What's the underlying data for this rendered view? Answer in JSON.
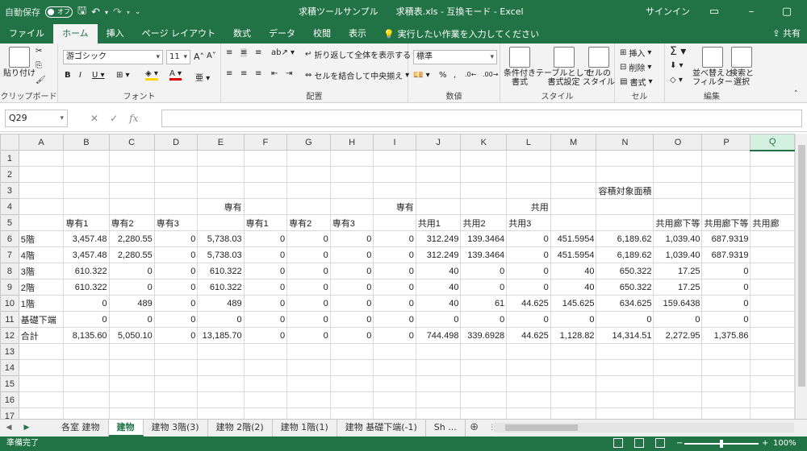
{
  "titlebar": {
    "autosave_label": "自動保存",
    "autosave_state": "オフ",
    "title": "求積ツールサンプル　　求積表.xls - 互換モード - Excel",
    "signin": "サインイン"
  },
  "tabs": [
    "ファイル",
    "ホーム",
    "挿入",
    "ページ レイアウト",
    "数式",
    "データ",
    "校閲",
    "表示"
  ],
  "tell_me": "実行したい作業を入力してください",
  "share": "共有",
  "ribbon": {
    "clipboard": {
      "paste": "貼り付け",
      "label": "クリップボード"
    },
    "font": {
      "name": "游ゴシック",
      "size": "11",
      "label": "フォント"
    },
    "alignment": {
      "wrap": "折り返して全体を表示する",
      "merge": "セルを結合して中央揃え",
      "label": "配置"
    },
    "number": {
      "format": "標準",
      "label": "数値"
    },
    "styles": {
      "conditional": "条件付き\n書式",
      "table": "テーブルとして\n書式設定",
      "cell": "セルの\nスタイル",
      "label": "スタイル"
    },
    "cells": {
      "insert": "挿入",
      "delete": "削除",
      "format": "書式",
      "label": "セル"
    },
    "editing": {
      "sort": "並べ替えと\nフィルター",
      "find": "検索と\n選択",
      "label": "編集"
    }
  },
  "formula_bar": {
    "name_box": "Q29",
    "formula": ""
  },
  "columns": [
    "A",
    "B",
    "C",
    "D",
    "E",
    "F",
    "G",
    "H",
    "I",
    "J",
    "K",
    "L",
    "M",
    "N",
    "O",
    "P",
    "Q"
  ],
  "selected_column": "Q",
  "rows": [
    {
      "n": "1",
      "cells": [
        "",
        "",
        "",
        "",
        "",
        "",
        "",
        "",
        "",
        "",
        "",
        "",
        "",
        "",
        "",
        "",
        ""
      ]
    },
    {
      "n": "2",
      "cells": [
        "",
        "",
        "",
        "",
        "",
        "",
        "",
        "",
        "",
        "",
        "",
        "",
        "",
        "",
        "",
        "",
        ""
      ]
    },
    {
      "n": "3",
      "cells": [
        "",
        "",
        "",
        "",
        "",
        "",
        "",
        "",
        "",
        "",
        "",
        "",
        "",
        "容積対象面積",
        "",
        "",
        ""
      ]
    },
    {
      "n": "4",
      "cells": [
        "",
        "",
        "",
        "",
        "専有",
        "",
        "",
        "",
        "専有",
        "",
        "",
        "共用",
        "",
        "",
        "",
        "",
        ""
      ]
    },
    {
      "n": "5",
      "cells": [
        "",
        "専有1",
        "専有2",
        "専有3",
        "",
        "専有1",
        "専有2",
        "専有3",
        "",
        "共用1",
        "共用2",
        "共用3",
        "",
        "",
        "共用廊下等",
        "共用廊下等",
        "共用廊"
      ]
    },
    {
      "n": "6",
      "cells": [
        "5階",
        "3,457.48",
        "2,280.55",
        "0",
        "5,738.03",
        "0",
        "0",
        "0",
        "0",
        "312.249",
        "139.3464",
        "0",
        "451.5954",
        "6,189.62",
        "1,039.40",
        "687.9319",
        ""
      ]
    },
    {
      "n": "7",
      "cells": [
        "4階",
        "3,457.48",
        "2,280.55",
        "0",
        "5,738.03",
        "0",
        "0",
        "0",
        "0",
        "312.249",
        "139.3464",
        "0",
        "451.5954",
        "6,189.62",
        "1,039.40",
        "687.9319",
        ""
      ]
    },
    {
      "n": "8",
      "cells": [
        "3階",
        "610.322",
        "0",
        "0",
        "610.322",
        "0",
        "0",
        "0",
        "0",
        "40",
        "0",
        "0",
        "40",
        "650.322",
        "17.25",
        "0",
        ""
      ]
    },
    {
      "n": "9",
      "cells": [
        "2階",
        "610.322",
        "0",
        "0",
        "610.322",
        "0",
        "0",
        "0",
        "0",
        "40",
        "0",
        "0",
        "40",
        "650.322",
        "17.25",
        "0",
        ""
      ]
    },
    {
      "n": "10",
      "cells": [
        "1階",
        "0",
        "489",
        "0",
        "489",
        "0",
        "0",
        "0",
        "0",
        "40",
        "61",
        "44.625",
        "145.625",
        "634.625",
        "159.6438",
        "0",
        ""
      ]
    },
    {
      "n": "11",
      "cells": [
        "基礎下端",
        "0",
        "0",
        "0",
        "0",
        "0",
        "0",
        "0",
        "0",
        "0",
        "0",
        "0",
        "0",
        "0",
        "0",
        "0",
        ""
      ]
    },
    {
      "n": "12",
      "cells": [
        "合計",
        "8,135.60",
        "5,050.10",
        "0",
        "13,185.70",
        "0",
        "0",
        "0",
        "0",
        "744.498",
        "339.6928",
        "44.625",
        "1,128.82",
        "14,314.51",
        "2,272.95",
        "1,375.86",
        ""
      ]
    },
    {
      "n": "13",
      "cells": [
        "",
        "",
        "",
        "",
        "",
        "",
        "",
        "",
        "",
        "",
        "",
        "",
        "",
        "",
        "",
        "",
        ""
      ]
    },
    {
      "n": "14",
      "cells": [
        "",
        "",
        "",
        "",
        "",
        "",
        "",
        "",
        "",
        "",
        "",
        "",
        "",
        "",
        "",
        "",
        ""
      ]
    },
    {
      "n": "15",
      "cells": [
        "",
        "",
        "",
        "",
        "",
        "",
        "",
        "",
        "",
        "",
        "",
        "",
        "",
        "",
        "",
        "",
        ""
      ]
    },
    {
      "n": "16",
      "cells": [
        "",
        "",
        "",
        "",
        "",
        "",
        "",
        "",
        "",
        "",
        "",
        "",
        "",
        "",
        "",
        "",
        ""
      ]
    },
    {
      "n": "17",
      "cells": [
        "",
        "",
        "",
        "",
        "",
        "",
        "",
        "",
        "",
        "",
        "",
        "",
        "",
        "",
        "",
        "",
        ""
      ]
    }
  ],
  "sheet_tabs": [
    "各室 建物",
    "建物",
    "建物 3階(3)",
    "建物 2階(2)",
    "建物 1階(1)",
    "建物 基礎下端(-1)",
    "Sh ..."
  ],
  "active_sheet": "建物",
  "status": {
    "ready": "準備完了",
    "zoom": "100%"
  }
}
